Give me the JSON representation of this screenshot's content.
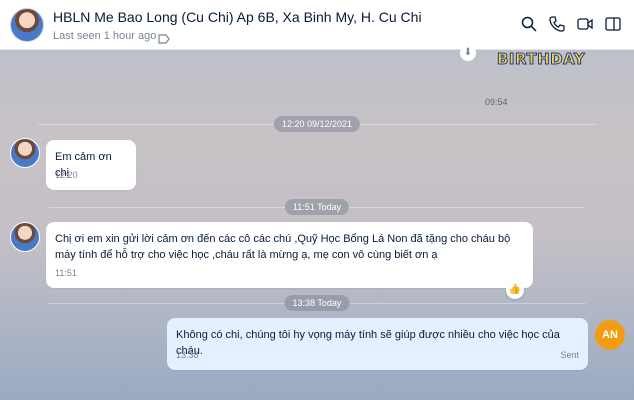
{
  "header": {
    "title": "HBLN Me Bao Long (Cu Chi) Ap 6B, Xa Binh My, H. Cu Chi",
    "subtitle": "Last seen 1 hour ago",
    "icons": [
      "search-icon",
      "phone-icon",
      "video-icon",
      "panel-icon"
    ]
  },
  "sticker": {
    "text": "BIRTHDAY",
    "time": "09:54"
  },
  "separators": [
    "12:20 09/12/2021",
    "11:51 Today",
    "13:38 Today"
  ],
  "messages": [
    {
      "text": "Em cảm ơn chị",
      "time": "12:20"
    },
    {
      "text": "Chị ơi em xin gửi lời cảm ơn đến các cô các chú ,Quỹ Học Bổng Lá Non đã tặng cho cháu bộ máy tính để hỗ trợ cho  việc học ,cháu rất là mừng ạ, mẹ con vô cùng biết ơn ạ",
      "time": "11:51"
    },
    {
      "text": "Không có chi, chúng tôi hy vọng máy tính sẽ giúp được nhiều cho việc học của cháu.",
      "time": "13:38",
      "status": "Sent"
    }
  ],
  "me": {
    "initials": "AN",
    "color": "#f39c12"
  }
}
